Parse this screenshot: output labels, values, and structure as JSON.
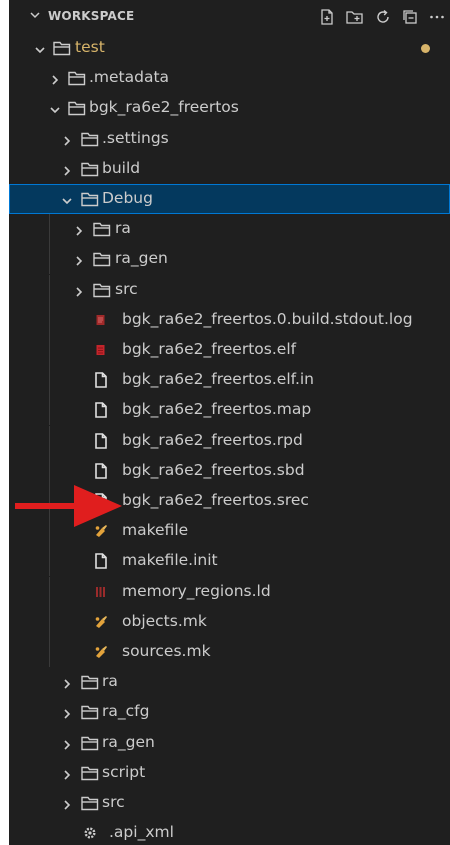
{
  "header": {
    "title": "WORKSPACE"
  },
  "colors": {
    "panel": "#1f1f1f",
    "text": "#cccccc",
    "modified": "#d7b46a",
    "selection": "#04395e",
    "selection_border": "#0078d4",
    "arrow": "#e01e1e"
  },
  "tree": [
    {
      "label": "test",
      "kind": "folder",
      "depth": 0,
      "expanded": true,
      "modified": true
    },
    {
      "label": ".metadata",
      "kind": "folder",
      "depth": 1,
      "expanded": false
    },
    {
      "label": "bgk_ra6e2_freertos",
      "kind": "folder",
      "depth": 1,
      "expanded": true
    },
    {
      "label": ".settings",
      "kind": "folder",
      "depth": 2,
      "expanded": false
    },
    {
      "label": "build",
      "kind": "folder",
      "depth": 2,
      "expanded": false
    },
    {
      "label": "Debug",
      "kind": "folder",
      "depth": 2,
      "expanded": true,
      "selected": true
    },
    {
      "label": "ra",
      "kind": "folder",
      "depth": 3,
      "expanded": false
    },
    {
      "label": "ra_gen",
      "kind": "folder",
      "depth": 3,
      "expanded": false
    },
    {
      "label": "src",
      "kind": "folder",
      "depth": 3,
      "expanded": false
    },
    {
      "label": "bgk_ra6e2_freertos.0.build.stdout.log",
      "kind": "log",
      "depth": 3
    },
    {
      "label": "bgk_ra6e2_freertos.elf",
      "kind": "elf",
      "depth": 3
    },
    {
      "label": "bgk_ra6e2_freertos.elf.in",
      "kind": "file",
      "depth": 3
    },
    {
      "label": "bgk_ra6e2_freertos.map",
      "kind": "file",
      "depth": 3
    },
    {
      "label": "bgk_ra6e2_freertos.rpd",
      "kind": "file",
      "depth": 3
    },
    {
      "label": "bgk_ra6e2_freertos.sbd",
      "kind": "file",
      "depth": 3
    },
    {
      "label": "bgk_ra6e2_freertos.srec",
      "kind": "file",
      "depth": 3,
      "highlighted_by_arrow": true
    },
    {
      "label": "makefile",
      "kind": "make",
      "depth": 3
    },
    {
      "label": "makefile.init",
      "kind": "file",
      "depth": 3
    },
    {
      "label": "memory_regions.ld",
      "kind": "ld",
      "depth": 3
    },
    {
      "label": "objects.mk",
      "kind": "make",
      "depth": 3
    },
    {
      "label": "sources.mk",
      "kind": "make",
      "depth": 3
    },
    {
      "label": "ra",
      "kind": "folder",
      "depth": 2,
      "expanded": false
    },
    {
      "label": "ra_cfg",
      "kind": "folder",
      "depth": 2,
      "expanded": false
    },
    {
      "label": "ra_gen",
      "kind": "folder",
      "depth": 2,
      "expanded": false
    },
    {
      "label": "script",
      "kind": "folder",
      "depth": 2,
      "expanded": false
    },
    {
      "label": "src",
      "kind": "folder",
      "depth": 2,
      "expanded": false
    },
    {
      "label": ".api_xml",
      "kind": "gear",
      "depth": 2
    }
  ]
}
